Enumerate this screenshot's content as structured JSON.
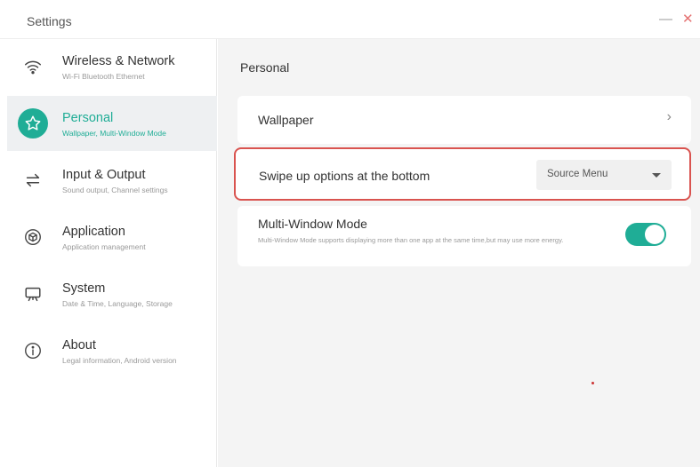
{
  "window": {
    "title": "Settings",
    "minimize_glyph": "—",
    "close_glyph": "✕"
  },
  "sidebar": {
    "items": [
      {
        "label": "Wireless & Network",
        "sub": "Wi-Fi Bluetooth Ethernet",
        "icon": "wifi-icon",
        "active": false
      },
      {
        "label": "Personal",
        "sub": "Wallpaper, Multi-Window Mode",
        "icon": "star-icon",
        "active": true
      },
      {
        "label": "Input & Output",
        "sub": "Sound output, Channel settings",
        "icon": "swap-arrows-icon",
        "active": false
      },
      {
        "label": "Application",
        "sub": "Application management",
        "icon": "cube-icon",
        "active": false
      },
      {
        "label": "System",
        "sub": "Date & Time, Language, Storage",
        "icon": "screen-icon",
        "active": false
      },
      {
        "label": "About",
        "sub": "Legal information, Android version",
        "icon": "info-icon",
        "active": false
      }
    ]
  },
  "main": {
    "section_title": "Personal",
    "wallpaper": {
      "label": "Wallpaper",
      "chevron": "›"
    },
    "swipe": {
      "label": "Swipe up options at the bottom",
      "selected": "Source Menu"
    },
    "multi_window": {
      "label": "Multi-Window Mode",
      "description": "Multi-Window Mode supports displaying more than one app at the same time,but may use more energy.",
      "enabled": true
    }
  },
  "colors": {
    "accent": "#1fad96",
    "highlight_border": "#d9534f",
    "active_row_bg": "#eef0f2",
    "content_bg": "#f4f4f4"
  }
}
